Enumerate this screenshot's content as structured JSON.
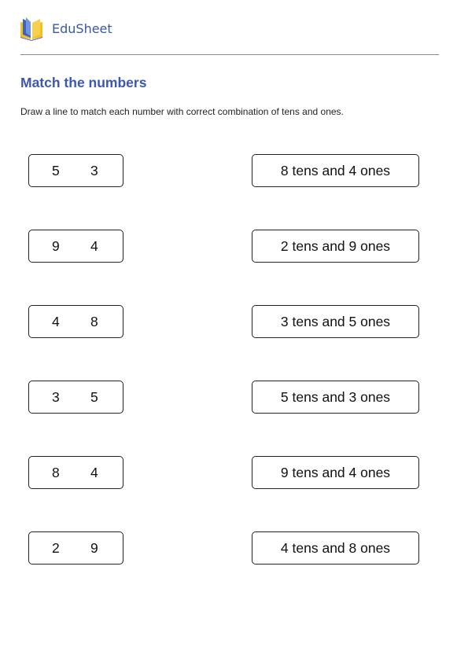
{
  "header": {
    "brand": "EduSheet",
    "logo_icon": "open-book-icon"
  },
  "title": "Match the numbers",
  "instruction": "Draw a line to match each number with correct combination of tens and ones.",
  "numbers": [
    {
      "tens": "5",
      "ones": "3"
    },
    {
      "tens": "9",
      "ones": "4"
    },
    {
      "tens": "4",
      "ones": "8"
    },
    {
      "tens": "3",
      "ones": "5"
    },
    {
      "tens": "8",
      "ones": "4"
    },
    {
      "tens": "2",
      "ones": "9"
    }
  ],
  "phrases": [
    "8 tens and 4 ones",
    "2 tens and 9 ones",
    "3 tens and 5 ones",
    "5 tens and 3 ones",
    "9 tens and 4 ones",
    "4 tens and 8 ones"
  ],
  "colors": {
    "accent": "#3a57b5",
    "logo_blue": "#3b62c4",
    "logo_yellow": "#f4c020"
  }
}
